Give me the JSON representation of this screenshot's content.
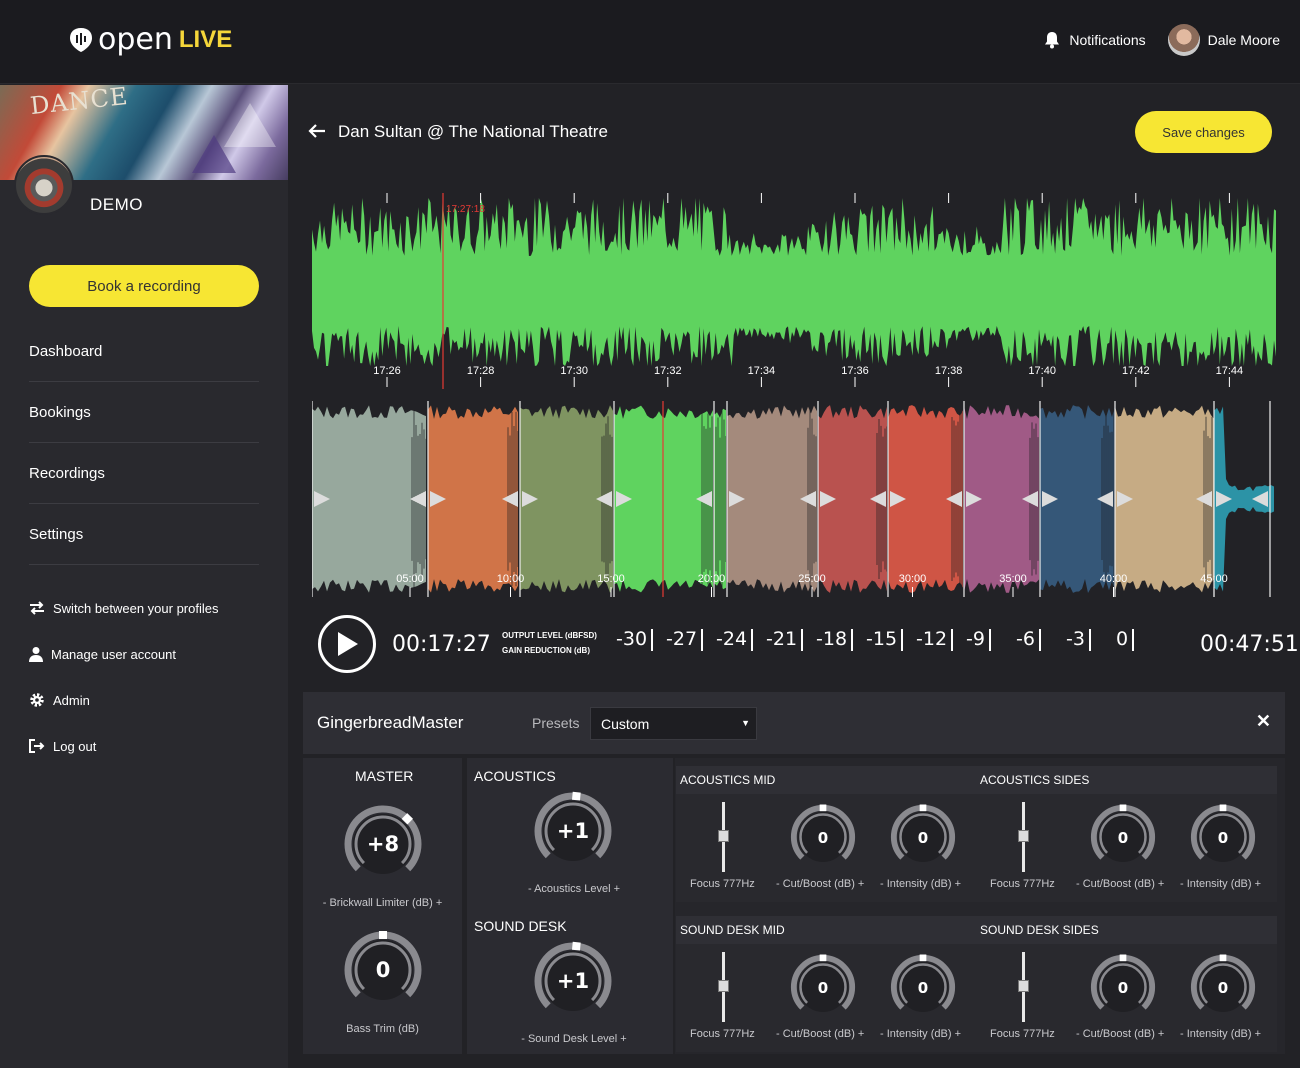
{
  "header": {
    "logo_open": "open",
    "logo_live": "LIVE",
    "notifications_label": "Notifications",
    "user_name": "Dale Moore"
  },
  "sidebar": {
    "cover_text": "DANCE",
    "profile_name": "DEMO",
    "book_label": "Book a recording",
    "nav": [
      "Dashboard",
      "Bookings",
      "Recordings",
      "Settings"
    ],
    "links": [
      {
        "icon": "switch-arrows-icon",
        "label": "Switch between your profiles"
      },
      {
        "icon": "user-icon",
        "label": "Manage user account"
      },
      {
        "icon": "gear-icon",
        "label": "Admin"
      },
      {
        "icon": "logout-icon",
        "label": "Log out"
      }
    ]
  },
  "page": {
    "title": "Dan Sultan @ The National Theatre",
    "save_label": "Save changes"
  },
  "overview_wave": {
    "color": "#5fd35f",
    "marker_color": "#e53935",
    "marker_label": "17:27:18",
    "ticks": [
      "17:26",
      "17:28",
      "17:30",
      "17:32",
      "17:34",
      "17:36",
      "17:38",
      "17:40",
      "17:42",
      "17:44"
    ]
  },
  "segments_wave": {
    "ticks": [
      "05:00",
      "10:00",
      "15:00",
      "20:00",
      "25:00",
      "30:00",
      "35:00",
      "40:00",
      "45:00"
    ],
    "segment_colors": [
      "#97a89d",
      "#d07448",
      "#7f9461",
      "#5fd35f",
      "#a48a7c",
      "#b9524f",
      "#cf5545",
      "#a05a86",
      "#355778",
      "#c6ab84",
      "#2c93a6"
    ]
  },
  "transport": {
    "current_time": "00:17:27",
    "total_time": "00:47:51",
    "output_label": "OUTPUT LEVEL (dBFSD)",
    "gain_label": "GAIN REDUCTION (dB)",
    "scale": [
      "-30",
      "-27",
      "-24",
      "-21",
      "-18",
      "-15",
      "-12",
      "-9",
      "-6",
      "-3",
      "0"
    ]
  },
  "effects": {
    "name": "GingerbreadMaster",
    "presets_label": "Presets",
    "preset_value": "Custom",
    "close": "✕",
    "master": {
      "title": "MASTER",
      "limiter_value": "+8",
      "limiter_label": "- Brickwall Limiter (dB) +",
      "bass_value": "0",
      "bass_label": "Bass Trim (dB)"
    },
    "acoustics": {
      "title": "ACOUSTICS",
      "value": "+1",
      "label": "- Acoustics Level +"
    },
    "sound_desk": {
      "title": "SOUND DESK",
      "value": "+1",
      "label": "- Sound Desk Level +"
    },
    "eq_sections": [
      {
        "title": "ACOUSTICS MID",
        "focus": "Focus 777Hz",
        "cut_value": "0",
        "cut_label": "- Cut/Boost (dB) +",
        "int_value": "0",
        "int_label": "- Intensity (dB) +"
      },
      {
        "title": "ACOUSTICS SIDES",
        "focus": "Focus 777Hz",
        "cut_value": "0",
        "cut_label": "- Cut/Boost (dB) +",
        "int_value": "0",
        "int_label": "- Intensity (dB) +"
      },
      {
        "title": "SOUND DESK MID",
        "focus": "Focus 777Hz",
        "cut_value": "0",
        "cut_label": "- Cut/Boost (dB) +",
        "int_value": "0",
        "int_label": "- Intensity (dB) +"
      },
      {
        "title": "SOUND DESK SIDES",
        "focus": "Focus 777Hz",
        "cut_value": "0",
        "cut_label": "- Cut/Boost (dB) +",
        "int_value": "0",
        "int_label": "- Intensity (dB) +"
      }
    ]
  }
}
